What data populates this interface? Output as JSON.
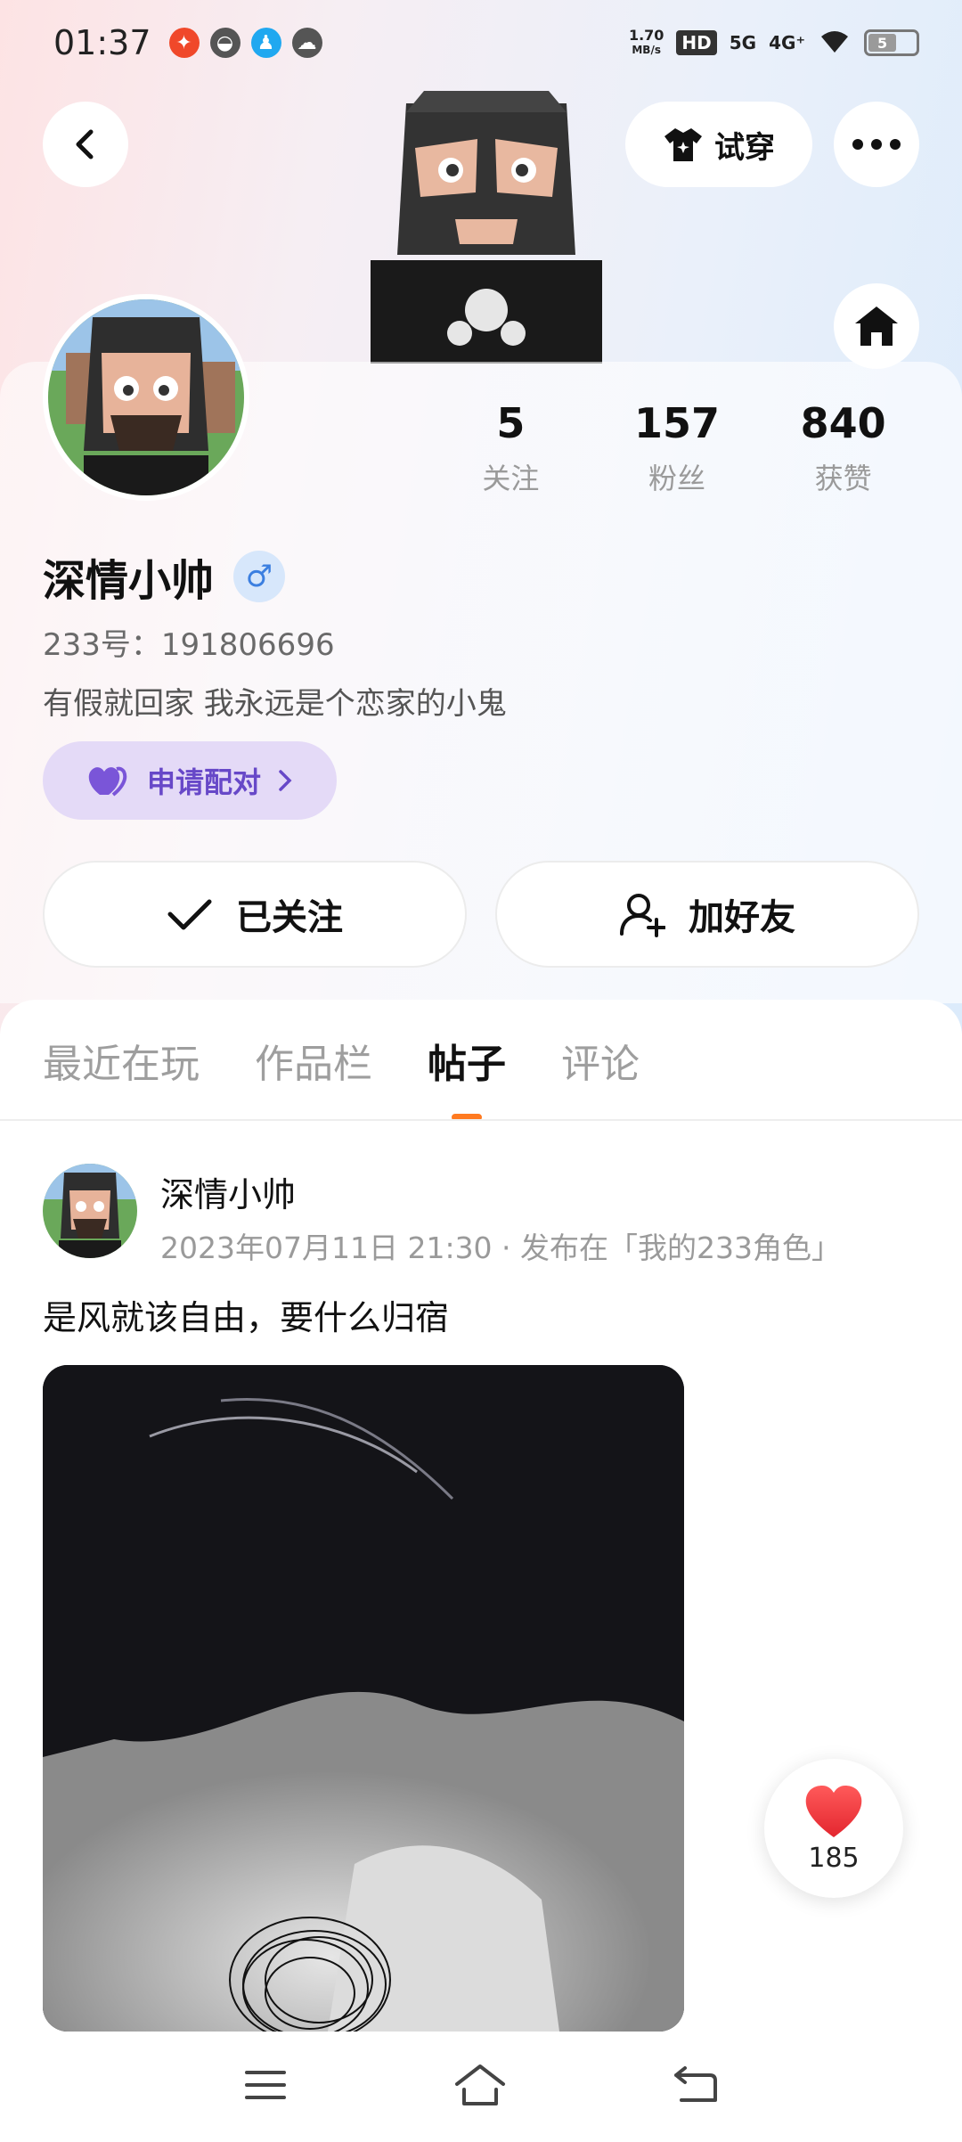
{
  "status_bar": {
    "time": "01:37",
    "net_speed_value": "1.70",
    "net_speed_unit": "MB/s",
    "hd_label": "HD",
    "sim1": "5G",
    "sim2": "4G⁺",
    "battery": "5"
  },
  "header": {
    "try_on_label": "试穿"
  },
  "profile": {
    "name": "深情小帅",
    "gender_symbol": "♂",
    "uid": "233号：191806696",
    "bio": "有假就回家  我永远是个恋家的小鬼",
    "pair_label": "申请配对",
    "stats": [
      {
        "value": "5",
        "label": "关注"
      },
      {
        "value": "157",
        "label": "粉丝"
      },
      {
        "value": "840",
        "label": "获赞"
      }
    ],
    "follow_label": "已关注",
    "add_friend_label": "加好友"
  },
  "tabs": [
    {
      "label": "最近在玩",
      "active": false
    },
    {
      "label": "作品栏",
      "active": false
    },
    {
      "label": "帖子",
      "active": true
    },
    {
      "label": "评论",
      "active": false
    }
  ],
  "post": {
    "author": "深情小帅",
    "meta": "2023年07月11日 21:30 · 发布在「我的233角色」",
    "text": "是风就该自由，要什么归宿",
    "likes": "185"
  },
  "colors": {
    "accent_orange": "#ff7a20",
    "pair_purple": "#6748c8",
    "like_red": "#f0353e"
  }
}
